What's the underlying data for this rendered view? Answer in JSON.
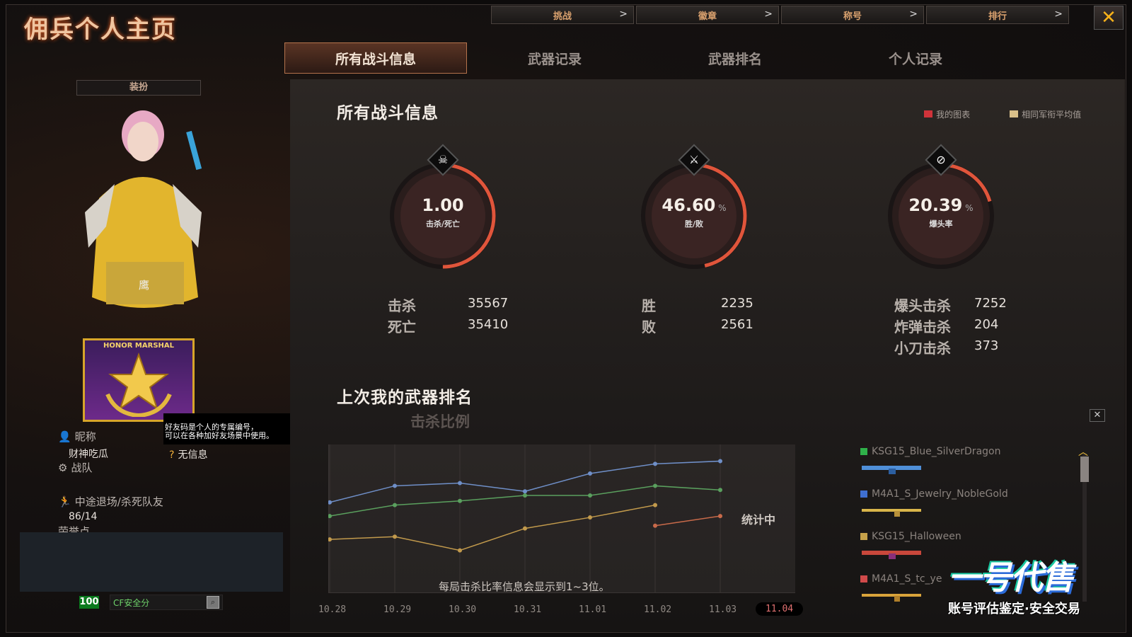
{
  "header": {
    "title": "佣兵个人主页",
    "top_nav": [
      {
        "label": "挑战",
        "chevron": ">"
      },
      {
        "label": "徽章",
        "chevron": ">"
      },
      {
        "label": "称号",
        "chevron": ">"
      },
      {
        "label": "排行",
        "chevron": ">"
      }
    ],
    "close": "✕"
  },
  "tabs": [
    {
      "label": "所有战斗信息",
      "active": true
    },
    {
      "label": "武器记录",
      "active": false
    },
    {
      "label": "武器排名",
      "active": false
    },
    {
      "label": "个人记录",
      "active": false
    }
  ],
  "left": {
    "outfit_button": "装扮",
    "character_name": "鹰",
    "badge_text": "HONOR MARSHAL",
    "tooltip_line1": "好友码是个人的专属编号，",
    "tooltip_line2": "可以在各种加好友场景中使用。",
    "nickname_label": "昵称",
    "nickname_value": "财神吃瓜",
    "info_value": "无信息",
    "team_label": "战队",
    "quit_label": "中途退场/杀死队友",
    "quit_value": "86/14",
    "praise_label": "荣誉点",
    "safety_score": "100",
    "safety_label": "CF安全分"
  },
  "main": {
    "section_title": "所有战斗信息",
    "legend": [
      {
        "label": "我的图表",
        "color": "#d0333a"
      },
      {
        "label": "相同军衔平均值",
        "color": "#d9c08a"
      }
    ],
    "gauges": [
      {
        "value": "1.00",
        "unit": "",
        "sub": "击杀/死亡",
        "fill": 0.5,
        "icon": "skull-icon",
        "glyph": "☠"
      },
      {
        "value": "46.60",
        "unit": "%",
        "sub": "胜/败",
        "fill": 0.466,
        "icon": "crossed-swords-icon",
        "glyph": "⚔"
      },
      {
        "value": "20.39",
        "unit": "%",
        "sub": "爆头率",
        "fill": 0.2039,
        "icon": "headshot-icon",
        "glyph": "⊘"
      }
    ],
    "stats": {
      "kills_label": "击杀",
      "kills": "35567",
      "deaths_label": "死亡",
      "deaths": "35410",
      "wins_label": "胜",
      "wins": "2235",
      "losses_label": "败",
      "losses": "2561",
      "headshot_label": "爆头击杀",
      "headshot": "7252",
      "bomb_label": "炸弹击杀",
      "bomb": "204",
      "knife_label": "小刀击杀",
      "knife": "373"
    },
    "ranking_title": "上次我的武器排名",
    "chart_subtitle": "击杀比例",
    "chart_status": "统计中",
    "chart_note": "每局击杀比率信息会显示到1~3位。",
    "close_small": "✕",
    "weapons": [
      {
        "name": "KSG15_Blue_SilverDragon",
        "color": "#2fb14a"
      },
      {
        "name": "M4A1_S_Jewelry_NobleGold",
        "color": "#3f6fd0"
      },
      {
        "name": "KSG15_Halloween",
        "color": "#c7a24a"
      },
      {
        "name": "M4A1_S_tc_ye",
        "color": "#d04a4a"
      }
    ]
  },
  "chart_data": {
    "type": "line",
    "categories": [
      "10.28",
      "10.29",
      "10.30",
      "10.31",
      "11.01",
      "11.02",
      "11.03",
      "11.04"
    ],
    "active_category": "11.04",
    "ylim": [
      0,
      100
    ],
    "series": [
      {
        "color": "#6f8fc8",
        "values": [
          62,
          74,
          76,
          70,
          83,
          90,
          92,
          null
        ]
      },
      {
        "color": "#5aa05e",
        "values": [
          52,
          60,
          63,
          67,
          67,
          74,
          71,
          null
        ]
      },
      {
        "color": "#c29a4c",
        "values": [
          35,
          37,
          27,
          43,
          51,
          60,
          null,
          null
        ]
      },
      {
        "color": "#c96a4a",
        "values": [
          null,
          null,
          null,
          null,
          null,
          45,
          52,
          null
        ]
      }
    ]
  },
  "watermark": {
    "main": "一号代售",
    "sub": "账号评估鉴定·安全交易"
  }
}
